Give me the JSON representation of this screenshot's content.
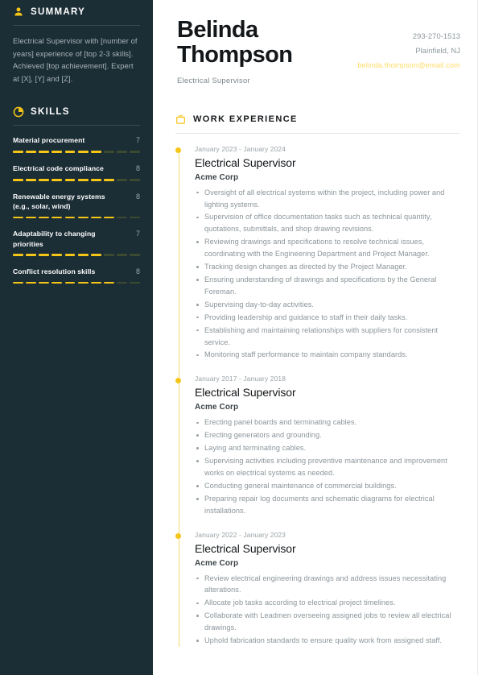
{
  "accent": {
    "yellow": "#f5c518",
    "light_yellow": "#ffdd6b",
    "sidebar_bg": "#1b2d35"
  },
  "header": {
    "first_name": "Belinda",
    "last_name": "Thompson",
    "role": "Electrical Supervisor",
    "phone": "293-270-1513",
    "location": "Plainfield, NJ",
    "email": "belinda.thompson@email.com"
  },
  "sidebar": {
    "summary": {
      "icon": "person-icon",
      "title": "SUMMARY",
      "text": "Electrical Supervisor with [number of years] experience of [top 2-3 skills]. Achieved [top achievement]. Expert at [X], [Y] and [Z]."
    },
    "skills": {
      "icon": "skill-meter-icon",
      "title": "SKILLS",
      "max": 10,
      "items": [
        {
          "name": "Material procurement",
          "score": 7
        },
        {
          "name": "Electrical code compliance",
          "score": 8
        },
        {
          "name": "Renewable energy systems (e.g., solar, wind)",
          "score": 8
        },
        {
          "name": "Adaptability to changing priorities",
          "score": 7
        },
        {
          "name": "Conflict resolution skills",
          "score": 8
        }
      ]
    }
  },
  "main": {
    "work_experience": {
      "icon": "briefcase-icon",
      "title": "WORK EXPERIENCE",
      "jobs": [
        {
          "dates": "January 2023 - January 2024",
          "title": "Electrical Supervisor",
          "company": "Acme Corp",
          "bullets": [
            "Oversight of all electrical systems within the project, including power and lighting systems.",
            "Supervision of office documentation tasks such as technical quantity, quotations, submittals, and shop drawing revisions.",
            "Reviewing drawings and specifications to resolve technical issues, coordinating with the Engineering Department and Project Manager.",
            "Tracking design changes as directed by the Project Manager.",
            "Ensuring understanding of drawings and specifications by the General Foreman.",
            "Supervising day-to-day activities.",
            "Providing leadership and guidance to staff in their daily tasks.",
            "Establishing and maintaining relationships with suppliers for consistent service.",
            "Monitoring staff performance to maintain company standards."
          ]
        },
        {
          "dates": "January 2017 - January 2018",
          "title": "Electrical Supervisor",
          "company": "Acme Corp",
          "bullets": [
            "Erecting panel boards and terminating cables.",
            "Erecting generators and grounding.",
            "Laying and terminating cables.",
            "Supervising activities including preventive maintenance and improvement works on electrical systems as needed.",
            "Conducting general maintenance of commercial buildings.",
            "Preparing repair log documents and schematic diagrams for electrical installations."
          ]
        },
        {
          "dates": "January 2022 - January 2023",
          "title": "Electrical Supervisor",
          "company": "Acme Corp",
          "bullets": [
            "Review electrical engineering drawings and address issues necessitating alterations.",
            "Allocate job tasks according to electrical project timelines.",
            "Collaborate with Leadmen overseeing assigned jobs to review all electrical drawings.",
            "Uphold fabrication standards to ensure quality work from assigned staff."
          ]
        }
      ]
    }
  }
}
